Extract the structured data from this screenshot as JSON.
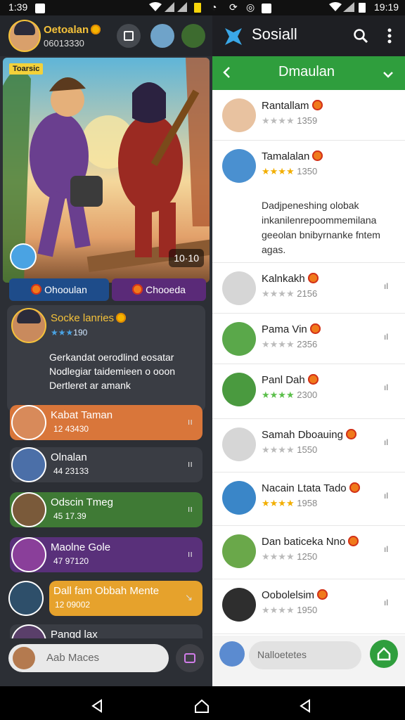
{
  "status": {
    "time_left": "1:39",
    "time_right": "19:19"
  },
  "left": {
    "profile": {
      "name": "Oetoalan",
      "number": "06013330"
    },
    "banner": {
      "tag": "Toarsic",
      "counter": "10·10"
    },
    "buttons": {
      "primary": "Ohooulan",
      "secondary": "Chooeda"
    },
    "post": {
      "title": "Socke lanries",
      "rating": "190",
      "body": "Gerkandat oerodlind eosatar Nodlegiar taidemieen o ooon Dertleret ar amank"
    },
    "chats": [
      {
        "title": "Kabat Taman",
        "sub": "12 43430",
        "menu": "ıı",
        "color": "#d9763a"
      },
      {
        "title": "Olnalan",
        "sub": "44 23133",
        "menu": "ıı",
        "color": "#3a3d44"
      },
      {
        "title": "Odscin Tmeg",
        "sub": "45 17.39",
        "menu": "ıı",
        "color": "#3f7a35"
      },
      {
        "title": "Maolne Gole",
        "sub": "47 97120",
        "menu": "ıı",
        "color": "#59307a"
      },
      {
        "title": "Dall fam Obbah Mente",
        "sub": "12 09002",
        "menu": "↘",
        "color": "#e6a22c"
      },
      {
        "title": "Pangd lax",
        "sub": "",
        "menu": "",
        "color": "#3a3d44"
      }
    ],
    "input": {
      "placeholder": "Aab Maces"
    }
  },
  "right": {
    "app_title": "Sosiall",
    "subheader": "Dmaulan",
    "contacts": [
      {
        "name": "Rantallam",
        "stars": "★★★★",
        "score": "1359",
        "starcolor": "gy",
        "extra": ""
      },
      {
        "name": "Tamalalan",
        "stars": "★★★★",
        "score": "1350",
        "starcolor": "go",
        "extra": ""
      },
      {
        "name": "Kalnkakh",
        "stars": "★★★★",
        "score": "2156",
        "starcolor": "gy",
        "extra": "ıl"
      },
      {
        "name": "Pama Vin",
        "stars": "★★★★",
        "score": "2356",
        "starcolor": "gy",
        "extra": "ıl"
      },
      {
        "name": "Panl Dah",
        "stars": "★★★★",
        "score": "2300",
        "starcolor": "st",
        "extra": "ıl"
      },
      {
        "name": "Samah Dboauing",
        "stars": "★★★★",
        "score": "1550",
        "starcolor": "gy",
        "extra": "ıl"
      },
      {
        "name": "Nacain Ltata Tado",
        "stars": "★★★★",
        "score": "1958",
        "starcolor": "go",
        "extra": "ıl"
      },
      {
        "name": "Dan baticeka Nno",
        "stars": "★★★★",
        "score": "1250",
        "starcolor": "gy",
        "extra": "ıl"
      },
      {
        "name": "Oobolelsim",
        "stars": "★★★★",
        "score": "1950",
        "starcolor": "gy",
        "extra": "ıl"
      }
    ],
    "description": "Dadjpeneshing olobak inkanilenrepoommemilana geeolan bnibyrnanke fntem agas.",
    "input": {
      "placeholder": "Nalloetetes"
    }
  }
}
